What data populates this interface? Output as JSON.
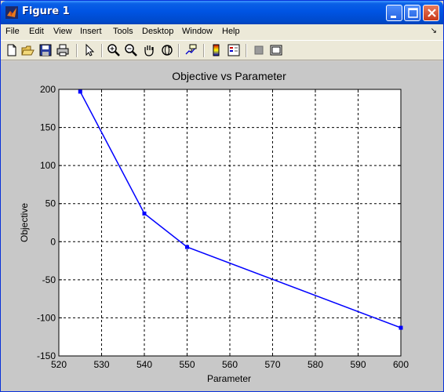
{
  "window": {
    "title": "Figure 1"
  },
  "menu": {
    "items": [
      "File",
      "Edit",
      "View",
      "Insert",
      "Tools",
      "Desktop",
      "Window",
      "Help"
    ],
    "overflow_glyph": "↘"
  },
  "toolbar": {
    "icons": [
      "new-file-icon",
      "open-folder-icon",
      "save-icon",
      "print-icon",
      "pointer-icon",
      "zoom-in-icon",
      "zoom-out-icon",
      "pan-hand-icon",
      "rotate-3d-icon",
      "data-cursor-icon",
      "colorbar-icon",
      "legend-icon",
      "hide-plot-tools-icon",
      "show-plot-tools-icon"
    ]
  },
  "colors": {
    "line": "#0000ff",
    "titlebar": "#0054e3",
    "figure_bg": "#c8c8c8",
    "axes_bg": "#ffffff"
  },
  "chart_data": {
    "type": "line",
    "title": "Objective vs Parameter",
    "xlabel": "Parameter",
    "ylabel": "Objective",
    "xlim": [
      520,
      600
    ],
    "ylim": [
      -150,
      200
    ],
    "xticks": [
      520,
      530,
      540,
      550,
      560,
      570,
      580,
      590,
      600
    ],
    "yticks": [
      200,
      150,
      100,
      50,
      0,
      -50,
      -100,
      -150
    ],
    "grid": true,
    "series": [
      {
        "x": [
          525,
          540,
          550,
          600
        ],
        "y": [
          197,
          37,
          -7,
          -113
        ],
        "marker": "square"
      }
    ]
  }
}
